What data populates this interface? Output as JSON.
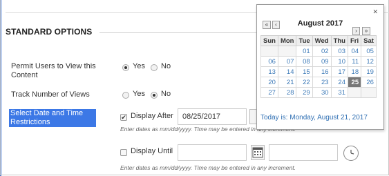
{
  "form": {
    "section_title": "STANDARD OPTIONS",
    "permit_label": "Permit Users to View this Content",
    "permit_yes": "Yes",
    "permit_no": "No",
    "track_label": "Track Number of Views",
    "track_yes": "Yes",
    "track_no": "No",
    "date_label": "Select Date and Time Restrictions",
    "display_after_label": "Display After",
    "display_after_value": "08/25/2017",
    "hint_after": "Enter dates as mm/dd/yyyy. Time may be entered in any increment.",
    "display_until_label": "Display Until",
    "display_until_value": "",
    "hint_until": "Enter dates as mm/dd/yyyy. Time may be entered in any increment.",
    "checkbox_mark": "✔"
  },
  "picker": {
    "close": "✕",
    "prev_year": "«",
    "prev_month": "‹",
    "next_month": "›",
    "next_year": "»",
    "title": "August 2017",
    "weekdays": [
      "Sun",
      "Mon",
      "Tue",
      "Wed",
      "Thu",
      "Fri",
      "Sat"
    ],
    "weeks": [
      [
        "",
        "",
        "01",
        "02",
        "03",
        "04",
        "05"
      ],
      [
        "06",
        "07",
        "08",
        "09",
        "10",
        "11",
        "12"
      ],
      [
        "13",
        "14",
        "15",
        "16",
        "17",
        "18",
        "19"
      ],
      [
        "20",
        "21",
        "22",
        "23",
        "24",
        "25",
        "26"
      ],
      [
        "27",
        "28",
        "29",
        "30",
        "31",
        "",
        ""
      ]
    ],
    "selected_day": "25",
    "today_text": "Today is: Monday, August 21, 2017"
  },
  "colors": {
    "highlight": "#3c78e6",
    "link_blue": "#3d7ab8",
    "selected_cell": "#777777"
  },
  "icons": {
    "calendar": "calendar-icon",
    "clock": "clock-icon",
    "close": "close-icon"
  }
}
